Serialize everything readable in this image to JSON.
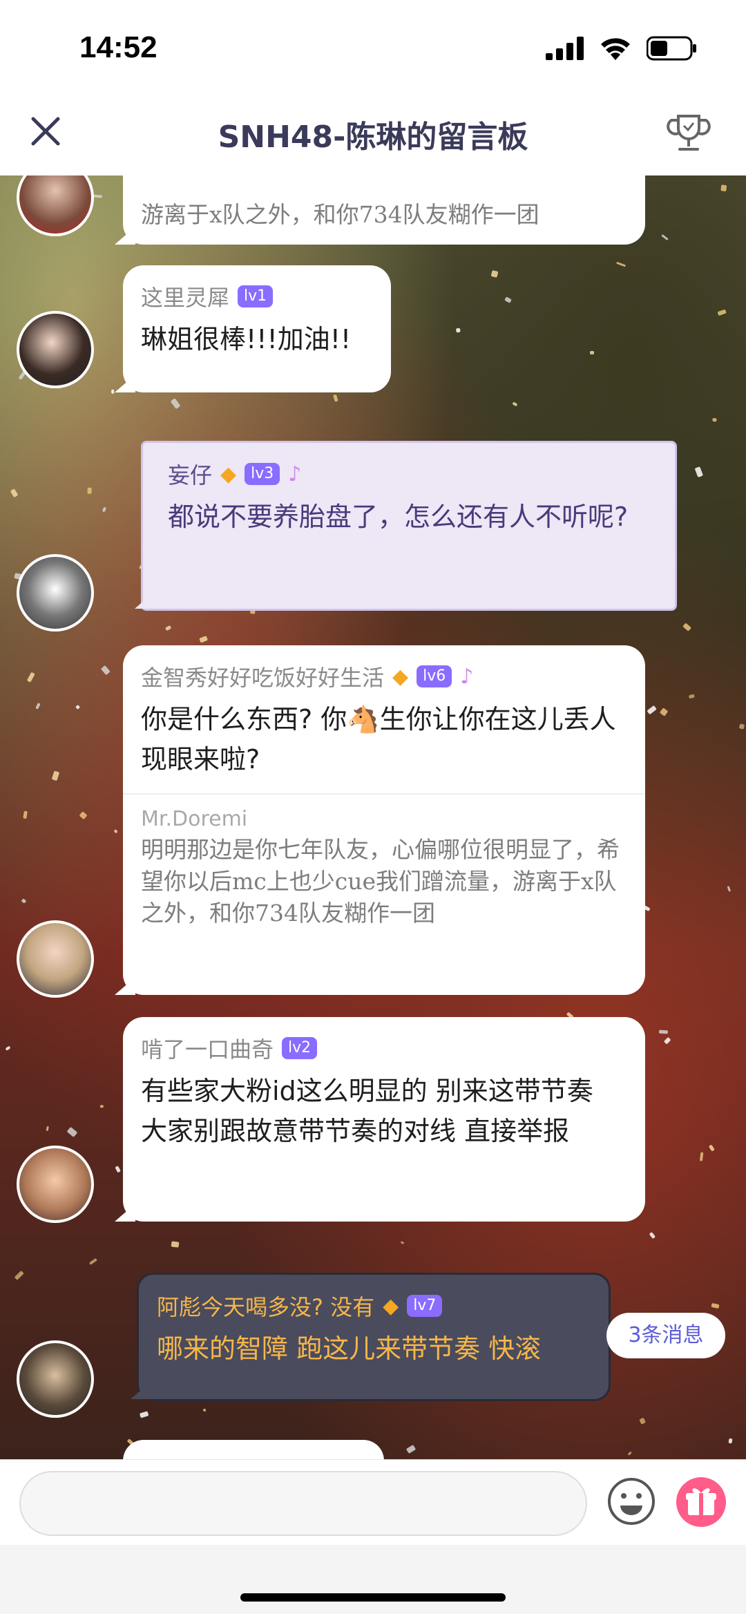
{
  "status": {
    "time": "14:52"
  },
  "header": {
    "title": "SNH48-陈琳的留言板"
  },
  "messages": [
    {
      "quote_tail": "游离于x队之外，和你734队友糊作一团"
    },
    {
      "user": "这里灵犀",
      "level": "lv1",
      "text": "琳姐很棒!!!加油!!"
    },
    {
      "user": "妄仔",
      "level": "lv3",
      "text": "都说不要养胎盘了，怎么还有人不听呢?"
    },
    {
      "user": "金智秀好好吃饭好好生活",
      "level": "lv6",
      "text": "你是什么东西? 你🐴生你让你在这儿丢人现眼来啦?",
      "quote": {
        "user": "Mr.Doremi",
        "text": "明明那边是你七年队友，心偏哪位很明显了，希望你以后mc上也少cue我们蹭流量，游离于x队之外，和你734队友糊作一团"
      }
    },
    {
      "user": "啃了一口曲奇",
      "level": "lv2",
      "text": "有些家大粉id这么明显的 别来这带节奏  大家别跟故意带节奏的对线  直接举报"
    },
    {
      "user": "阿彪今天喝多没? 没有",
      "level": "lv7",
      "text": "哪来的智障 跑这儿来带节奏 快滚"
    }
  ],
  "new_messages_pill": "3条消息",
  "colors": {
    "accent": "#8a6cff",
    "pill_text": "#5b5bd6",
    "gift": "#ff5c8a"
  }
}
